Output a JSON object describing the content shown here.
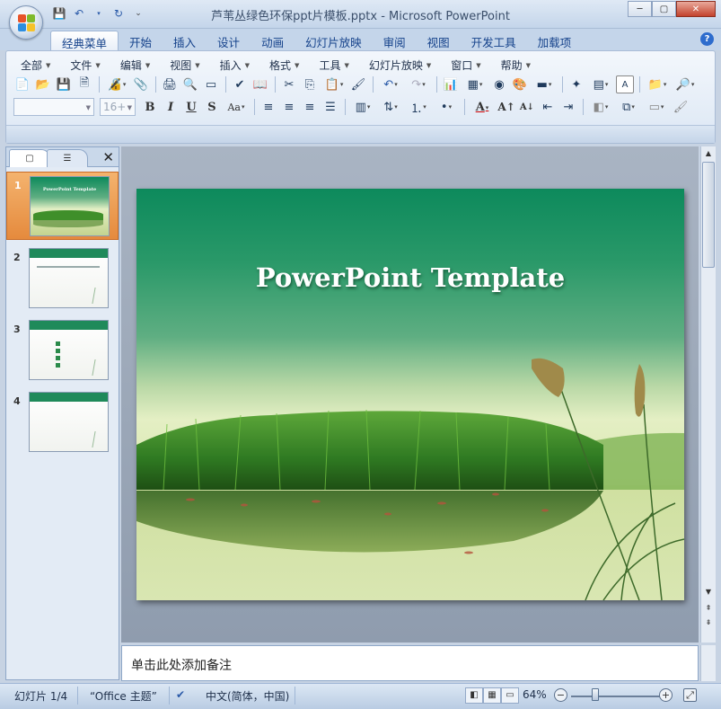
{
  "window": {
    "title": "芦苇丛绿色环保ppt片模板.pptx - Microsoft PowerPoint",
    "controls": {
      "minimize": "─",
      "maximize": "▢",
      "close": "✕"
    }
  },
  "ribbon": {
    "tabs": [
      "经典菜单",
      "开始",
      "插入",
      "设计",
      "动画",
      "幻灯片放映",
      "审阅",
      "视图",
      "开发工具",
      "加载项"
    ],
    "active_tab": "经典菜单",
    "menus": [
      "全部",
      "文件",
      "编辑",
      "视图",
      "插入",
      "格式",
      "工具",
      "幻灯片放映",
      "窗口",
      "帮助"
    ],
    "font_size": "16+",
    "help": "?"
  },
  "slide_panel": {
    "thumbnails": [
      {
        "number": "1",
        "title": "PowerPoint Template"
      },
      {
        "number": "2"
      },
      {
        "number": "3"
      },
      {
        "number": "4"
      }
    ],
    "close": "✕"
  },
  "slide": {
    "title": "PowerPoint Template"
  },
  "notes": {
    "placeholder": "单击此处添加备注"
  },
  "status": {
    "slide_indicator": "幻灯片 1/4",
    "theme": "“Office 主题”",
    "language": "中文(简体，中国)",
    "zoom": "64%"
  }
}
